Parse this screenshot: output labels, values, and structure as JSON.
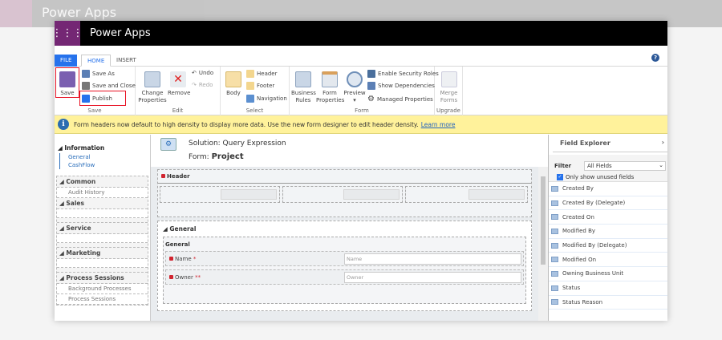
{
  "app": {
    "title": "Power Apps"
  },
  "tabs": {
    "file": "FILE",
    "home": "HOME",
    "insert": "INSERT"
  },
  "ribbon": {
    "save": {
      "label": "Save",
      "save_as": "Save As",
      "save_and_close": "Save and Close",
      "publish": "Publish",
      "group": "Save"
    },
    "edit": {
      "change_properties": "Change Properties",
      "remove": "Remove",
      "undo": "Undo",
      "redo": "Redo",
      "group": "Edit"
    },
    "select": {
      "body": "Body",
      "header": "Header",
      "footer": "Footer",
      "navigation": "Navigation",
      "group": "Select"
    },
    "form": {
      "business_rules": "Business Rules",
      "form_properties": "Form Properties",
      "preview": "Preview",
      "enable_security_roles": "Enable Security Roles",
      "show_dependencies": "Show Dependencies",
      "managed_properties": "Managed Properties",
      "group": "Form"
    },
    "upgrade": {
      "merge_forms": "Merge Forms",
      "group": "Upgrade"
    }
  },
  "notice": {
    "text": "Form headers now default to high density to display more data. Use the new form designer to edit header density.",
    "link": "Learn more"
  },
  "nav": {
    "information": "Information",
    "links": [
      "General",
      "CashFlow"
    ],
    "sections": [
      {
        "title": "Common",
        "items": [
          "Audit History"
        ]
      },
      {
        "title": "Sales",
        "items": []
      },
      {
        "title": "Service",
        "items": []
      },
      {
        "title": "Marketing",
        "items": []
      },
      {
        "title": "Process Sessions",
        "items": [
          "Background Processes",
          "Process Sessions"
        ]
      }
    ]
  },
  "form": {
    "solution": "Solution: Query Expression",
    "form_label": "Form:",
    "form_name": "Project",
    "header": "Header",
    "tab": "General",
    "section": "General",
    "fields": [
      {
        "label": "Name",
        "placeholder": "Name"
      },
      {
        "label": "Owner",
        "placeholder": "Owner"
      }
    ]
  },
  "field_explorer": {
    "title": "Field Explorer",
    "filter_label": "Filter",
    "filter_value": "All Fields",
    "only_unused": "Only show unused fields",
    "fields": [
      "Created By",
      "Created By (Delegate)",
      "Created On",
      "Modified By",
      "Modified By (Delegate)",
      "Modified On",
      "Owning Business Unit",
      "Status",
      "Status Reason"
    ]
  }
}
